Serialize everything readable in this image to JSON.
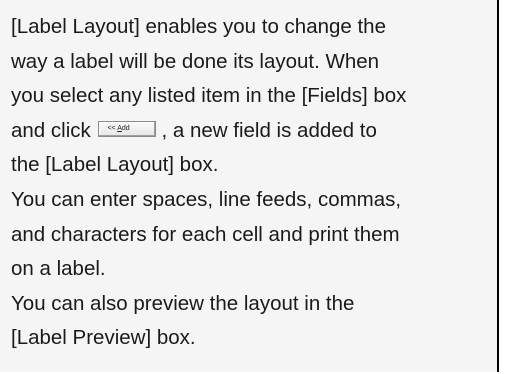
{
  "help": {
    "lines": [
      "[Label Layout] enables you to change the",
      "way a label will be done its layout. When",
      "you select any listed item in the [Fields] box",
      "and click",
      ", a new field is added to",
      "the [Label Layout] box.",
      "You can enter spaces, line feeds, commas,",
      "and characters for each cell and print them",
      "on a label.",
      "You can also preview the layout in the",
      "[Label Preview] box."
    ],
    "add_button": {
      "arrows": "<<",
      "accel": "A",
      "rest": "dd"
    }
  }
}
